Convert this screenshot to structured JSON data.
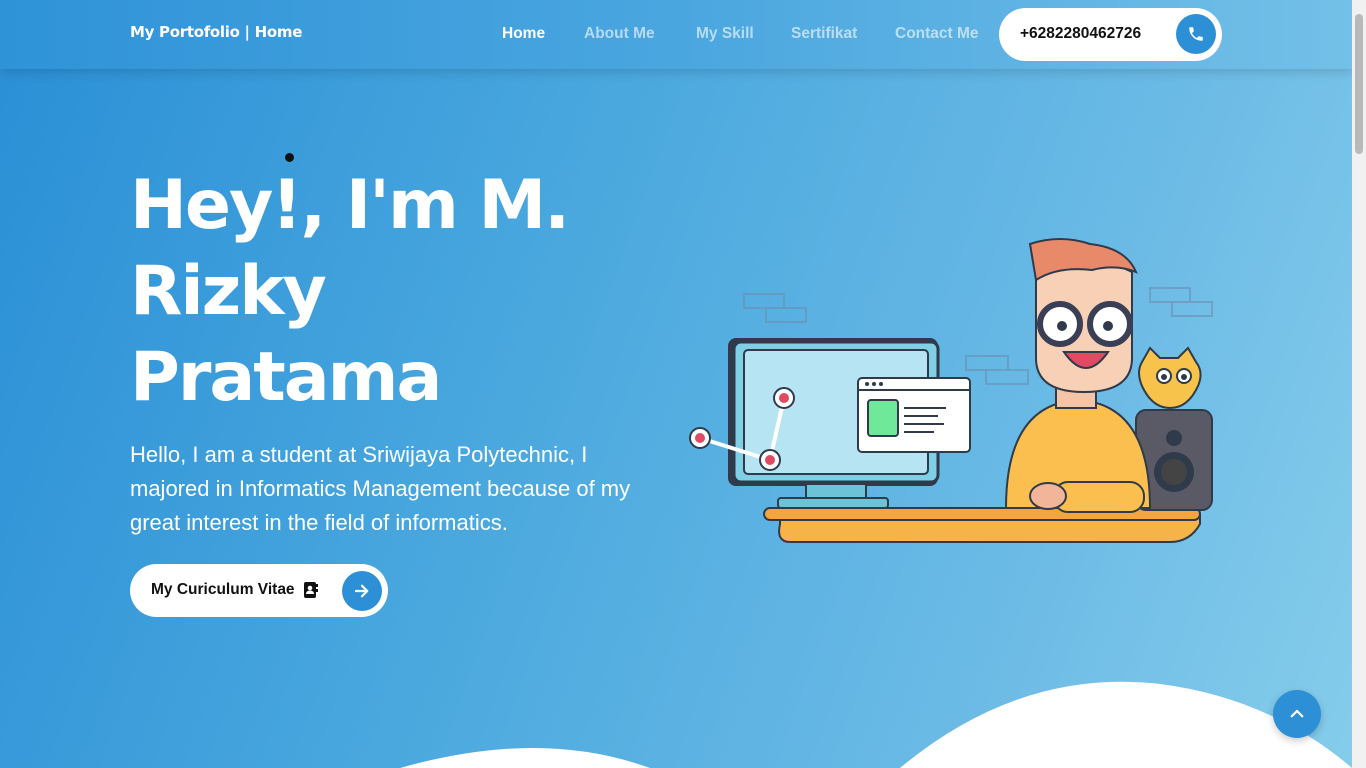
{
  "navbar": {
    "brand": "My Portofolio | Home",
    "links": [
      "Home",
      "About Me",
      "My Skill",
      "Sertifikat",
      "Contact Me"
    ],
    "phone": "+6282280462726"
  },
  "hero": {
    "title": "Hey!, I'm M. Rizky Pratama",
    "description": "Hello, I am a student at Sriwijaya Polytechnic, I majored in Informatics Management because of my great interest in the field of informatics.",
    "cv_button": "My Curiculum Vitae"
  },
  "icons": {
    "phone": "phone-icon",
    "cv": "address-book-icon",
    "cv_arrow": "arrow-right-icon",
    "back_to_top": "chevron-up-icon"
  },
  "colors": {
    "accent": "#2d8fd5",
    "gradient_start": "#2a8fd6",
    "gradient_end": "#86cdeb",
    "white": "#ffffff"
  }
}
